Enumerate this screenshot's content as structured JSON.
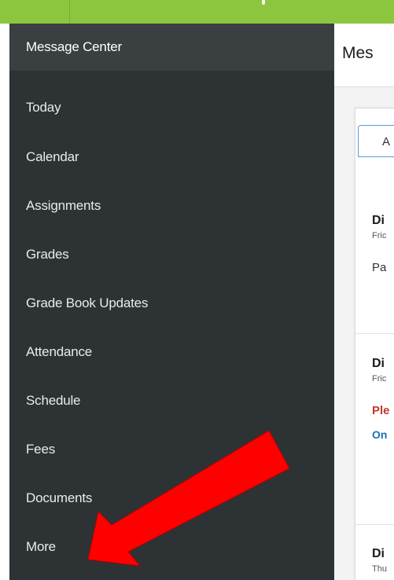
{
  "sidebar": {
    "items": [
      {
        "label": "Message Center",
        "active": true
      },
      {
        "label": "Today"
      },
      {
        "label": "Calendar"
      },
      {
        "label": "Assignments"
      },
      {
        "label": "Grades"
      },
      {
        "label": "Grade Book Updates"
      },
      {
        "label": "Attendance"
      },
      {
        "label": "Schedule"
      },
      {
        "label": "Fees"
      },
      {
        "label": "Documents"
      },
      {
        "label": "More"
      }
    ]
  },
  "main": {
    "title": "Mes",
    "tab_label": "A",
    "messages": [
      {
        "title": "Di",
        "date": "Fric",
        "body": "Pa"
      },
      {
        "title": "Di",
        "date": "Fric",
        "warning": "Ple",
        "link": "On"
      },
      {
        "title": "Di",
        "date": "Thu"
      }
    ]
  },
  "colors": {
    "header_green": "#8cc63f",
    "sidebar_bg": "#2d3235",
    "sidebar_active": "#3a3f42",
    "arrow_red": "#ff0000",
    "warning_red": "#c0392b",
    "link_blue": "#1f6fb8"
  },
  "annotation": {
    "shape": "red-arrow",
    "points_to": "More"
  }
}
